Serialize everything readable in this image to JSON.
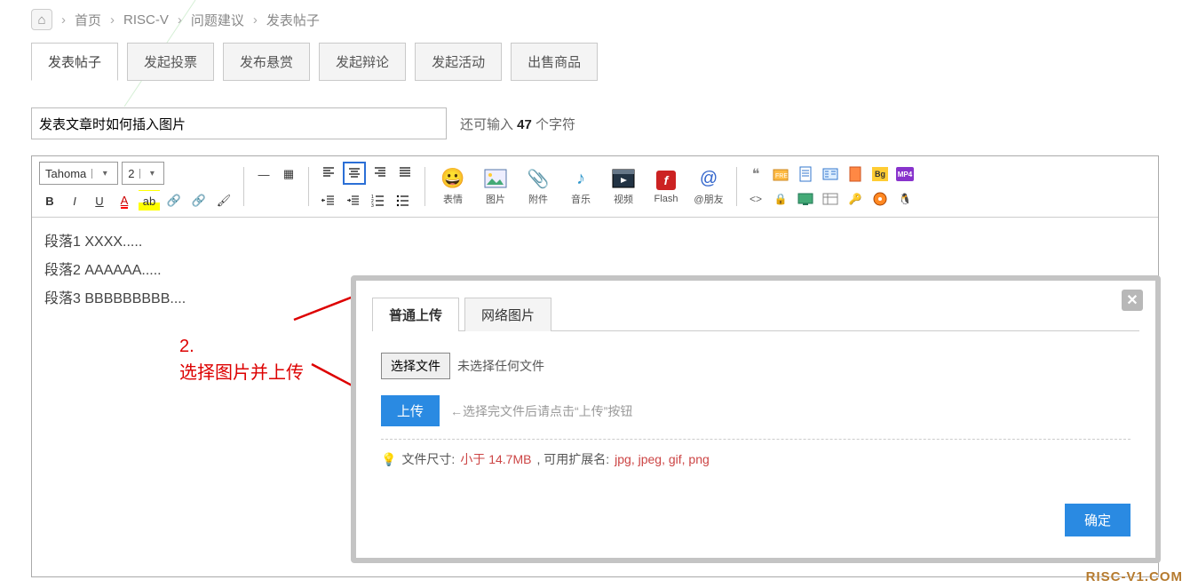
{
  "breadcrumb": {
    "home": "⌂",
    "items": [
      "首页",
      "RISC-V",
      "问题建议",
      "发表帖子"
    ]
  },
  "tabs": [
    "发表帖子",
    "发起投票",
    "发布悬赏",
    "发起辩论",
    "发起活动",
    "出售商品"
  ],
  "title": {
    "value": "发表文章时如何插入图片",
    "remain_pre": "还可输入 ",
    "remain_num": "47",
    "remain_suf": " 个字符"
  },
  "toolbar": {
    "font": "Tahoma",
    "size": "2",
    "big": [
      {
        "k": "emoji",
        "l": "表情"
      },
      {
        "k": "image",
        "l": "图片"
      },
      {
        "k": "attach",
        "l": "附件"
      },
      {
        "k": "music",
        "l": "音乐"
      },
      {
        "k": "video",
        "l": "视频"
      },
      {
        "k": "flash",
        "l": "Flash"
      },
      {
        "k": "at",
        "l": "@朋友"
      }
    ]
  },
  "body_lines": [
    "段落1   XXXX.....",
    "段落2   AAAAAA.....",
    "段落3     BBBBBBBBB...."
  ],
  "annotation": {
    "num": "2.",
    "text": "选择图片并上传"
  },
  "dialog": {
    "tabs": [
      "普通上传",
      "网络图片"
    ],
    "choose_btn": "选择文件",
    "choose_status": "未选择任何文件",
    "upload_btn": "上传",
    "upload_hint": "←选择完文件后请点击“上传”按钮",
    "size_label": "文件尺寸: ",
    "size_limit": "小于 14.7MB",
    "size_mid": " , 可用扩展名: ",
    "size_ext": "jpg, jpeg, gif, png",
    "ok": "确定"
  },
  "watermark": "RISC-V1.COM"
}
